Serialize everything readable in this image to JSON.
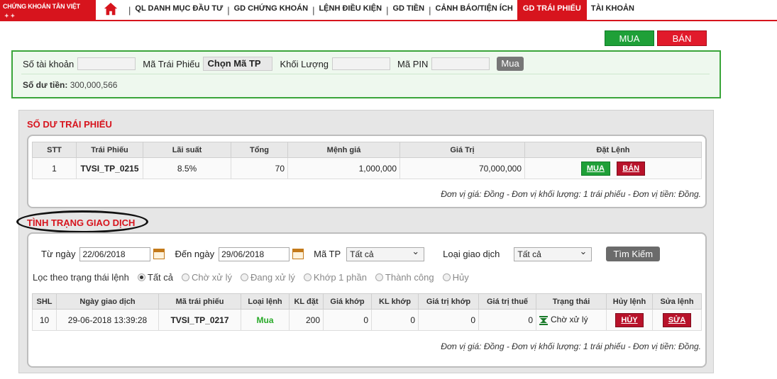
{
  "brand": {
    "logo_text": "CHỨNG KHOÁN TÂN VIỆT"
  },
  "nav": {
    "items": [
      "QL DANH MỤC ĐẦU TƯ",
      "GD CHỨNG KHOÁN",
      "LỆNH ĐIỀU KIỆN",
      "GD TIỀN",
      "CẢNH BÁO/TIỆN ÍCH",
      "GD TRÁI PHIẾU",
      "TÀI KHOẢN"
    ],
    "active": "GD TRÁI PHIẾU"
  },
  "top_actions": {
    "buy": "MUA",
    "sell": "BÁN"
  },
  "order_form": {
    "account_label": "Số tài khoản",
    "bond_code_label": "Mã Trái Phiếu",
    "bond_code_value": "Chọn Mã TP",
    "volume_label": "Khối Lượng",
    "pin_label": "Mã PIN",
    "submit": "Mua",
    "balance_label": "Số dư tiền:",
    "balance_value": "300,000,566"
  },
  "bond_balance": {
    "title": "SỐ DƯ TRÁI PHIẾU",
    "columns": [
      "STT",
      "Trái Phiếu",
      "Lãi suất",
      "Tổng",
      "Mệnh giá",
      "Giá Trị",
      "Đặt Lệnh"
    ],
    "rows": [
      {
        "stt": "1",
        "bond": "TVSI_TP_0215",
        "rate": "8.5%",
        "total": "70",
        "face_value": "1,000,000",
        "value": "70,000,000",
        "buy": "MUA",
        "sell": "BÁN"
      }
    ],
    "note": "Đơn vị giá: Đồng - Đơn vị khối lượng: 1 trái phiếu - Đơn vị tiền: Đồng."
  },
  "trade_status": {
    "title": "TÌNH TRẠNG GIAO DỊCH",
    "from_label": "Từ ngày",
    "from_value": "22/06/2018",
    "to_label": "Đến ngày",
    "to_value": "29/06/2018",
    "code_label": "Mã TP",
    "code_value": "Tất cả",
    "type_label": "Loại giao dịch",
    "type_value": "Tất cả",
    "search": "Tìm Kiếm",
    "filter_label": "Lọc theo trạng thái lệnh",
    "filters": [
      "Tất cả",
      "Chờ xử lý",
      "Đang xử lý",
      "Khớp 1 phần",
      "Thành công",
      "Hủy"
    ],
    "columns": [
      "SHL",
      "Ngày giao dịch",
      "Mã trái phiếu",
      "Loại lệnh",
      "KL đặt",
      "Giá khớp",
      "KL khớp",
      "Giá trị khớp",
      "Giá trị thuế",
      "Trạng thái",
      "Hủy lệnh",
      "Sửa lệnh"
    ],
    "rows": [
      {
        "shl": "10",
        "date": "29-06-2018 13:39:28",
        "bond": "TVSI_TP_0217",
        "type": "Mua",
        "qty": "200",
        "match_price": "0",
        "match_qty": "0",
        "match_value": "0",
        "tax": "0",
        "status": "Chờ xử lý",
        "cancel": "HỦY",
        "edit": "SỬA"
      }
    ],
    "note": "Đơn vị giá: Đồng - Đơn vị khối lượng: 1 trái phiếu - Đơn vị tiền: Đồng."
  },
  "colors": {
    "brand_red": "#d7141d",
    "buy_green": "#1fa038",
    "sell_red": "#e11a2b"
  }
}
